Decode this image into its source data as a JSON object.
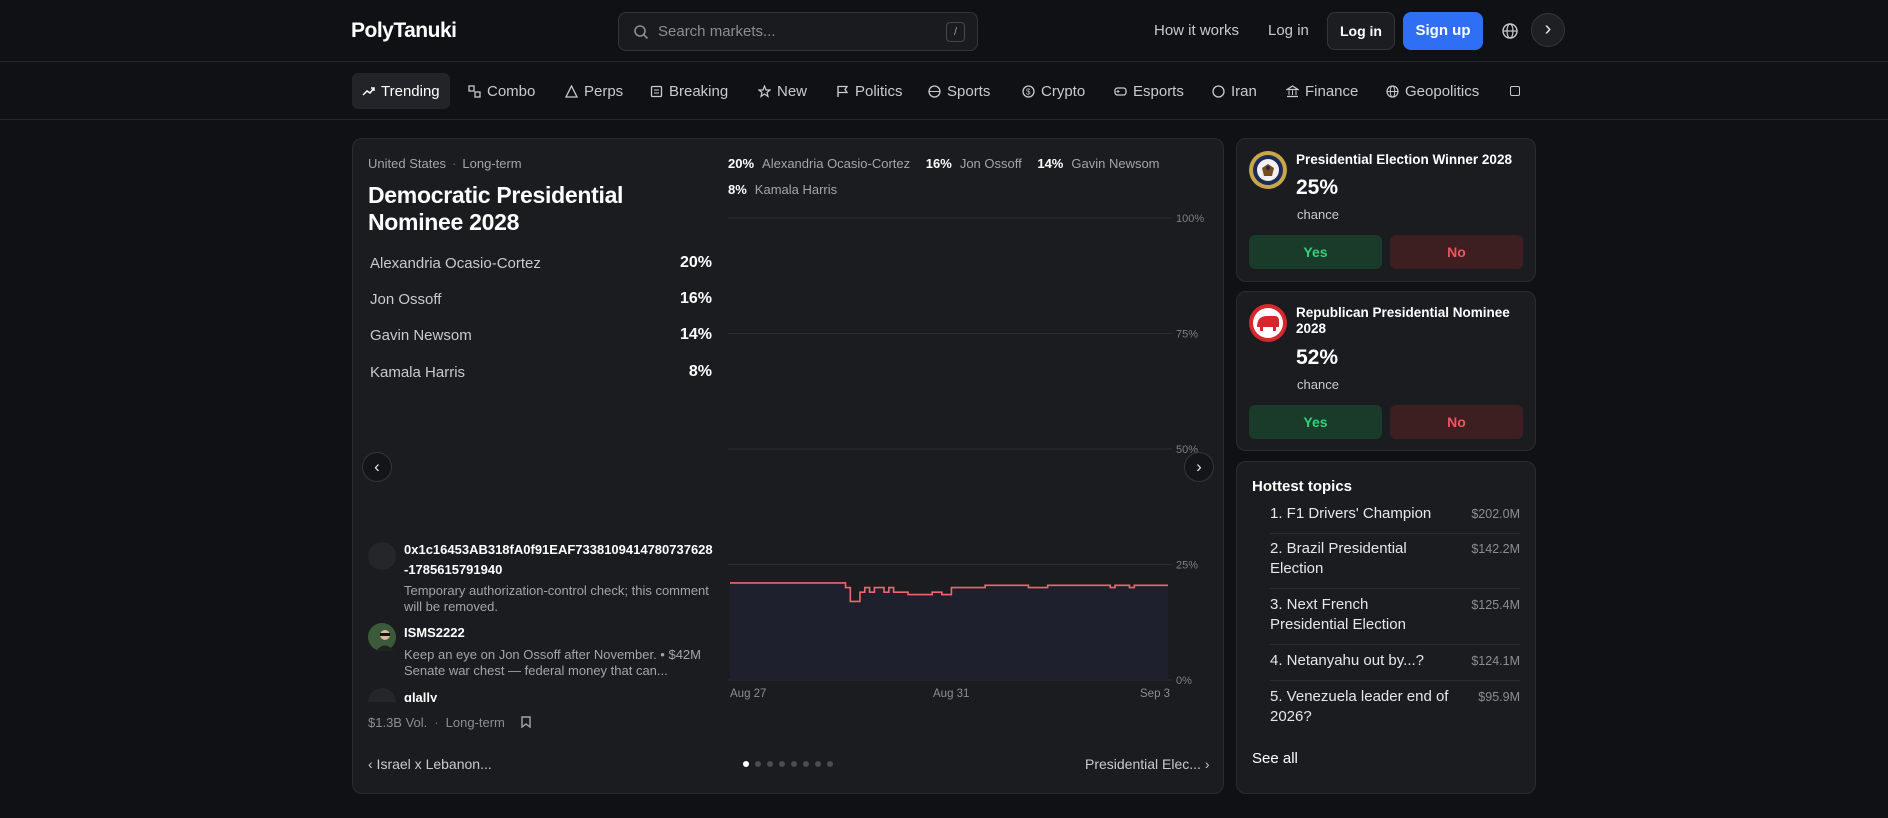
{
  "header": {
    "logo": "PolyTanuki",
    "search_placeholder": "Search markets...",
    "search_shortcut": "/",
    "how_it_works": "How it works",
    "login_link": "Log in",
    "login_button": "Log in",
    "signup_button": "Sign up"
  },
  "categories": [
    {
      "label": "Trending",
      "icon": "trending-icon",
      "active": true
    },
    {
      "label": "Combo",
      "icon": "combo-icon"
    },
    {
      "label": "Perps",
      "icon": "perps-icon"
    },
    {
      "label": "Breaking",
      "icon": "breaking-icon"
    },
    {
      "label": "New",
      "icon": "star-icon"
    },
    {
      "label": "Politics",
      "icon": "flag-icon"
    },
    {
      "label": "Sports",
      "icon": "sports-icon"
    },
    {
      "label": "Crypto",
      "icon": "crypto-icon"
    },
    {
      "label": "Esports",
      "icon": "gamepad-icon"
    },
    {
      "label": "Iran",
      "icon": "circle-icon"
    },
    {
      "label": "Finance",
      "icon": "bank-icon"
    },
    {
      "label": "Geopolitics",
      "icon": "globe-icon"
    }
  ],
  "featured": {
    "region": "United States",
    "term": "Long-term",
    "title": "Democratic Presidential Nominee 2028",
    "outcomes": [
      {
        "name": "Alexandria Ocasio-Cortez",
        "pct": "20%"
      },
      {
        "name": "Jon Ossoff",
        "pct": "16%"
      },
      {
        "name": "Gavin Newsom",
        "pct": "14%"
      },
      {
        "name": "Kamala Harris",
        "pct": "8%"
      }
    ],
    "comments": [
      {
        "user": "0x1c16453AB318fA0f91EAF7338109414780737628-1785615791940",
        "text": "Temporary authorization-control check; this comment will be removed."
      },
      {
        "user": "ISMS2222",
        "text": "Keep an eye on Jon Ossoff after November. • $42M Senate war chest — federal money that can..."
      },
      {
        "user": "glally",
        "text": ""
      }
    ],
    "volume": "$1.3B Vol.",
    "footer_term": "Long-term",
    "prev_market": "‹ Israel x Lebanon...",
    "next_market": "Presidential Elec... ›",
    "page_count": 8,
    "current_page": 1
  },
  "chart_data": {
    "type": "line",
    "x_ticks": [
      "Aug 27",
      "Aug 31",
      "Sep 3"
    ],
    "y_ticks": [
      "100%",
      "75%",
      "50%",
      "25%",
      "0%"
    ],
    "ylim": [
      0,
      100
    ],
    "grid": true,
    "legend_placement": "top",
    "series": [
      {
        "name": "Alexandria Ocasio-Cortez",
        "color": "#f0676b",
        "values": [
          21,
          21,
          21,
          21,
          21,
          21,
          21,
          21,
          21,
          21,
          21,
          21,
          21,
          21,
          21,
          21,
          21,
          21,
          21,
          21,
          21,
          21,
          21,
          21,
          20,
          17,
          17,
          19,
          20,
          19,
          20,
          20,
          19,
          20,
          19,
          19,
          19,
          18.5,
          18.5,
          18.5,
          18.5,
          18.5,
          19,
          19,
          18.5,
          18.5,
          20,
          20,
          20,
          20,
          20,
          20,
          20,
          20.5,
          20.5,
          20.5,
          20.5,
          20.5,
          20.5,
          20.5,
          20.5,
          20.5,
          20,
          20,
          20,
          20,
          20.5,
          20.5,
          20.5,
          20.5,
          20.5,
          20.5,
          20.5,
          20.5,
          20.5,
          20.5,
          20.5,
          20.5,
          20.5,
          20,
          20.5,
          20.5,
          20.5,
          20,
          20.5,
          20.5,
          20.5,
          20.5,
          20.5,
          20.5,
          20.5,
          20.5
        ]
      }
    ],
    "legend": [
      {
        "pct": "20%",
        "name": "Alexandria Ocasio-Cortez"
      },
      {
        "pct": "16%",
        "name": "Jon Ossoff"
      },
      {
        "pct": "14%",
        "name": "Gavin Newsom"
      },
      {
        "pct": "8%",
        "name": "Kamala Harris"
      }
    ]
  },
  "side_markets": [
    {
      "title": "Presidential Election Winner 2028",
      "pct": "25%",
      "chance": "chance",
      "yes": "Yes",
      "no": "No",
      "icon": "presidential-seal-icon"
    },
    {
      "title": "Republican Presidential Nominee 2028",
      "pct": "52%",
      "chance": "chance",
      "yes": "Yes",
      "no": "No",
      "icon": "republican-elephant-icon"
    }
  ],
  "hottest": {
    "title": "Hottest topics",
    "items": [
      {
        "name": "1. F1 Drivers' Champion",
        "vol": "$202.0M"
      },
      {
        "name": "2. Brazil Presidential Election",
        "vol": "$142.2M"
      },
      {
        "name": "3. Next French Presidential Election",
        "vol": "$125.4M"
      },
      {
        "name": "4. Netanyahu out by...?",
        "vol": "$124.1M"
      },
      {
        "name": "5. Venezuela leader end of 2026?",
        "vol": "$95.9M"
      }
    ],
    "see_all": "See all"
  },
  "colors": {
    "accent": "#2f6ff5",
    "yes": "#33d17a",
    "no": "#f0545c",
    "line": "#f0676b"
  }
}
